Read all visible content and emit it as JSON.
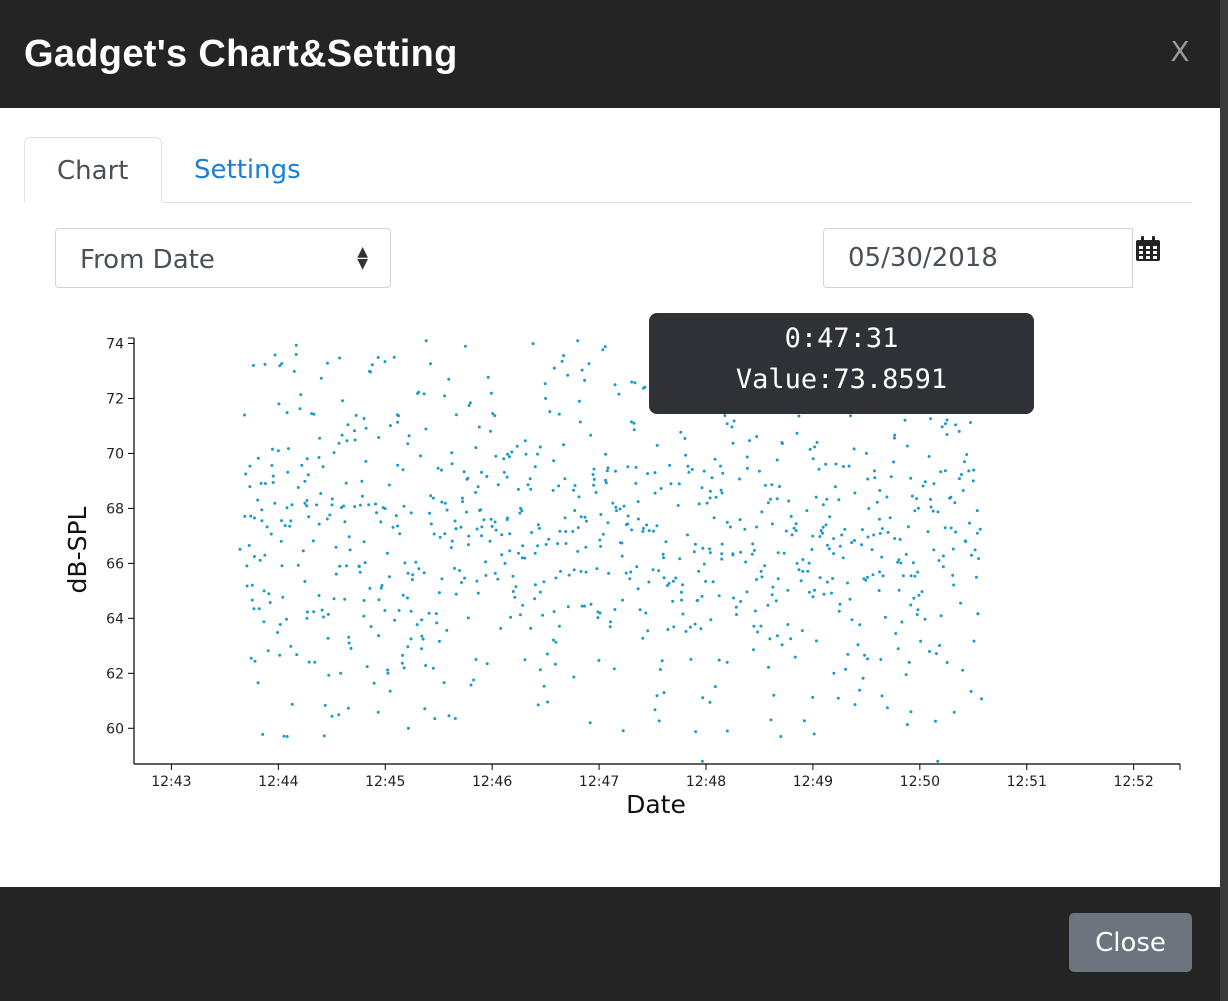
{
  "dialog": {
    "title": "Gadget's Chart&Setting",
    "close_icon": "close-icon",
    "close_glyph": "X"
  },
  "tabs": [
    {
      "label": "Chart",
      "active": true
    },
    {
      "label": "Settings",
      "active": false
    }
  ],
  "filter": {
    "mode_select": {
      "selected": "From Date",
      "icon": "sort-arrows-icon"
    },
    "date_input": {
      "value": "05/30/2018"
    },
    "calendar_icon": "calendar-icon"
  },
  "tooltip": {
    "time": "0:47:31",
    "value_text": "Value:73.8591"
  },
  "footer": {
    "close_label": "Close"
  },
  "colors": {
    "header_bg": "#242424",
    "point": "#1a9bc7",
    "tab_link": "#1a7fd4",
    "close_btn": "#6c757d",
    "tooltip_bg": "#2f3136"
  },
  "chart_data": {
    "type": "scatter",
    "xlabel": "Date",
    "ylabel": "dB-SPL",
    "x_tick_labels": [
      "12:43",
      "12:44",
      "12:45",
      "12:46",
      "12:47",
      "12:48",
      "12:49",
      "12:50",
      "12:51",
      "12:52"
    ],
    "y_tick_labels": [
      "60",
      "62",
      "64",
      "66",
      "68",
      "70",
      "72",
      "74"
    ],
    "xlim": [
      "12:42:39",
      "12:52:26"
    ],
    "ylim": [
      58.7,
      74.2
    ],
    "point_count": 900,
    "x_range_of_points": [
      "12:43:40",
      "12:50:35"
    ],
    "y_range_of_points": [
      58.8,
      74.1
    ],
    "sample_points": [
      {
        "x": "12:43:41",
        "y": 71.4
      },
      {
        "x": "12:43:46",
        "y": 73.2
      },
      {
        "x": "12:43:52",
        "y": 65.0
      },
      {
        "x": "12:44:00",
        "y": 70.1
      },
      {
        "x": "12:44:05",
        "y": 59.7
      },
      {
        "x": "12:44:10",
        "y": 73.6
      },
      {
        "x": "12:44:35",
        "y": 62.0
      },
      {
        "x": "12:45:05",
        "y": 73.5
      },
      {
        "x": "12:45:13",
        "y": 60.0
      },
      {
        "x": "12:45:23",
        "y": 74.1
      },
      {
        "x": "12:45:45",
        "y": 73.9
      },
      {
        "x": "12:46:30",
        "y": 72.0
      },
      {
        "x": "12:46:48",
        "y": 74.1
      },
      {
        "x": "12:46:55",
        "y": 60.2
      },
      {
        "x": "12:47:31",
        "y": 73.86
      },
      {
        "x": "12:47:58",
        "y": 58.8
      },
      {
        "x": "12:48:12",
        "y": 59.9
      },
      {
        "x": "12:48:42",
        "y": 59.7
      },
      {
        "x": "12:49:30",
        "y": 70.0
      },
      {
        "x": "12:49:55",
        "y": 60.6
      },
      {
        "x": "12:50:10",
        "y": 58.8
      },
      {
        "x": "12:50:30",
        "y": 69.0
      }
    ],
    "grid": false,
    "legend": "none"
  }
}
